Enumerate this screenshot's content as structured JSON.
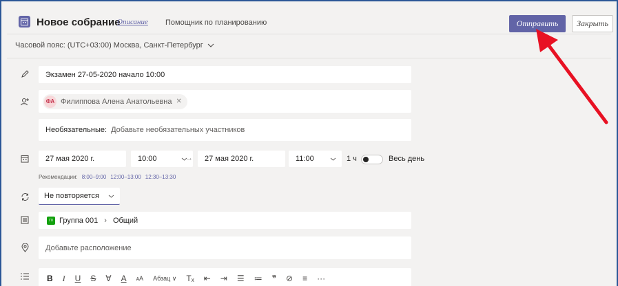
{
  "header": {
    "title": "Новое собрание",
    "tab_description": "Описание",
    "tab_assistant": "Помощник по планированию",
    "send_label": "Отправить",
    "close_label": "Закрыть"
  },
  "timezone": "Часовой пояс: (UTC+03:00) Москва, Санкт-Петербург",
  "form": {
    "title_value": "Экзамен 27-05-2020 начало 10:00",
    "attendee": {
      "initials": "ФА",
      "name": "Филиппова Алена Анатольевна"
    },
    "optional_label": "Необязательные:",
    "optional_placeholder": "Добавьте необязательных участников",
    "start_date": "27 мая 2020 г.",
    "start_time": "10:00",
    "end_date": "27 мая 2020 г.",
    "end_time": "11:00",
    "duration": "1 ч",
    "all_day_label": "Весь день",
    "recommend_label": "Рекомендации:",
    "recommend_slots": [
      "8:00–9:00",
      "12:00–13:00",
      "12:30–13:30"
    ],
    "repeat_value": "Не повторяется",
    "channel_badge": "Г0",
    "channel_team": "Группа 001",
    "channel_name": "Общий",
    "location_placeholder": "Добавьте расположение",
    "toolbar": {
      "bold": "B",
      "italic": "I",
      "underline": "U",
      "strike": "S",
      "highlight": "∀",
      "font_color": "A",
      "font_size": "ᴀA",
      "paragraph": "Абзац ∨",
      "clear_format": "Tₓ",
      "outdent": "⇤",
      "indent": "⇥",
      "bullets": "☰",
      "numbers": "≔",
      "quote": "❞",
      "link": "⊘",
      "align": "≡",
      "more": "···"
    }
  },
  "colors": {
    "accent": "#6264a7",
    "arrow": "#e81123",
    "frame": "#2b5797"
  }
}
